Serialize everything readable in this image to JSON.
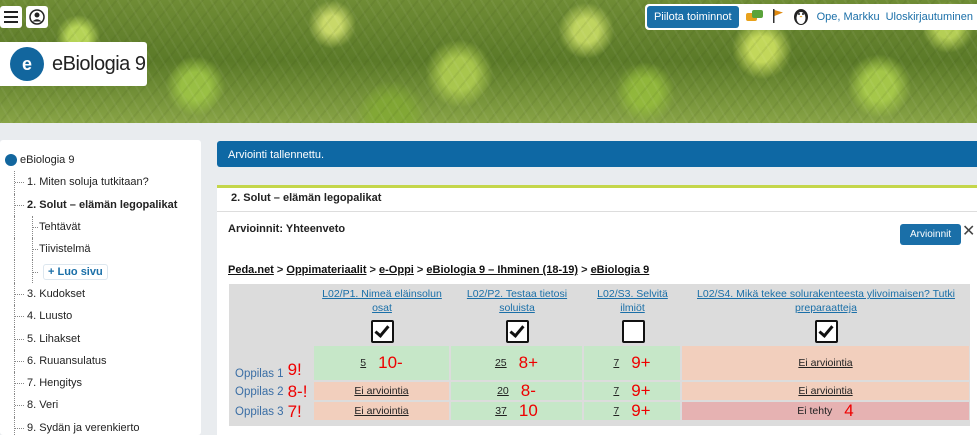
{
  "topbar": {
    "hide_button": "Piilota toiminnot",
    "user": "Ope, Markku",
    "logout": "Uloskirjautuminen"
  },
  "logo": {
    "text": "eBiologia 9"
  },
  "sidebar": {
    "root": "eBiologia 9",
    "items": [
      {
        "label": "1. Miten soluja tutkitaan?"
      },
      {
        "label": "2. Solut – elämän legopalikat"
      },
      {
        "label": "Tehtävät"
      },
      {
        "label": "Tiivistelmä"
      },
      {
        "label": "+ Luo sivu"
      },
      {
        "label": "3. Kudokset"
      },
      {
        "label": "4. Luusto"
      },
      {
        "label": "5. Lihakset"
      },
      {
        "label": "6. Ruuansulatus"
      },
      {
        "label": "7. Hengitys"
      },
      {
        "label": "8. Veri"
      },
      {
        "label": "9. Sydän ja verenkierto"
      }
    ]
  },
  "notice": "Arviointi tallennettu.",
  "panel": {
    "title": "2. Solut – elämän legopalikat",
    "subtitle": "Arvioinnit: Yhteenveto",
    "grade_button": "Arvioinnit",
    "close": "✕"
  },
  "breadcrumbs": [
    "Peda.net",
    "Oppimateriaalit",
    "e-Oppi",
    "eBiologia 9 – Ihminen (18-19)",
    "eBiologia 9"
  ],
  "breadcrumb_sep": " > ",
  "table": {
    "columns": [
      {
        "title": "L02/P1. Nimeä eläinsolun osat",
        "checked": true
      },
      {
        "title": "L02/P2. Testaa tietosi soluista",
        "checked": true
      },
      {
        "title": "L02/S3. Selvitä ilmiöt",
        "checked": false
      },
      {
        "title": "L02/S4. Mikä tekee solurakenteesta ylivoimaisen? Tutki preparaatteja",
        "checked": true
      }
    ],
    "rows": [
      {
        "pupil": "Oppilas 1",
        "overall": "9!",
        "cells": [
          {
            "status": "green",
            "link": "5",
            "score": "10-"
          },
          {
            "status": "green",
            "link": "25",
            "score": "8+"
          },
          {
            "status": "green",
            "link": "7",
            "score": "9+"
          },
          {
            "status": "orange",
            "link": "Ei arviointia",
            "score": ""
          }
        ]
      },
      {
        "pupil": "Oppilas 2",
        "overall": "8-!",
        "cells": [
          {
            "status": "orange",
            "link": "Ei arviointia",
            "score": ""
          },
          {
            "status": "green",
            "link": "20",
            "score": "8-"
          },
          {
            "status": "green",
            "link": "7",
            "score": "9+"
          },
          {
            "status": "orange",
            "link": "Ei arviointia",
            "score": ""
          }
        ]
      },
      {
        "pupil": "Oppilas 3",
        "overall": "7!",
        "cells": [
          {
            "status": "orange",
            "link": "Ei arviointia",
            "score": ""
          },
          {
            "status": "green",
            "link": "37",
            "score": "10"
          },
          {
            "status": "green",
            "link": "7",
            "score": "9+"
          },
          {
            "status": "red",
            "text": "Ei tehty",
            "score": "4"
          }
        ]
      }
    ]
  },
  "colors": {
    "accent": "#1a6fa8",
    "green": "#c6e7c8",
    "orange": "#f2cfbd",
    "red": "#e6b2b2",
    "score": "#e00000"
  }
}
